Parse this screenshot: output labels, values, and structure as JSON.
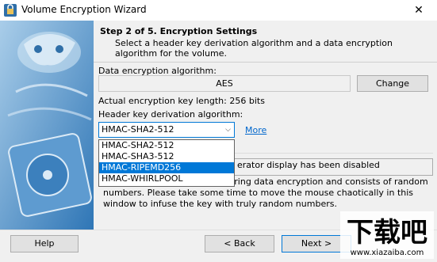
{
  "window": {
    "title": "Volume Encryption Wizard",
    "close_glyph": "✕"
  },
  "header": {
    "step_title": "Step 2 of 5. Encryption Settings",
    "step_desc": "Select a header key derivation algorithm and a data encryption algorithm for the volume."
  },
  "encryption": {
    "label": "Data encryption algorithm:",
    "value": "AES",
    "change_label": "Change",
    "key_length": "Actual encryption key length: 256 bits"
  },
  "hash": {
    "label": "Header key derivation algorithm:",
    "selected": "HMAC-SHA2-512",
    "more_link": "More",
    "options": [
      "HMAC-SHA2-512",
      "HMAC-SHA3-512",
      "HMAC-RIPEMD256",
      "HMAC-WHIRLPOOL"
    ],
    "highlighted_index": 2
  },
  "random": {
    "checkbox_partial": "erator display has been disabled",
    "text": "The encryption key is used during data encryption and consists of random numbers. Please take some time to move the mouse chaotically in this window to infuse the key with truly random numbers."
  },
  "footer": {
    "help": "Help",
    "back": "< Back",
    "next": "Next >"
  },
  "watermark": {
    "text": "下载吧",
    "url": "www.xiazaiba.com"
  },
  "colors": {
    "accent": "#0078d7",
    "link": "#0066cc",
    "art_blue": "#4f8fc6"
  },
  "icons": [
    "app-icon",
    "close-icon",
    "chevron-down-icon",
    "wizard-art"
  ]
}
